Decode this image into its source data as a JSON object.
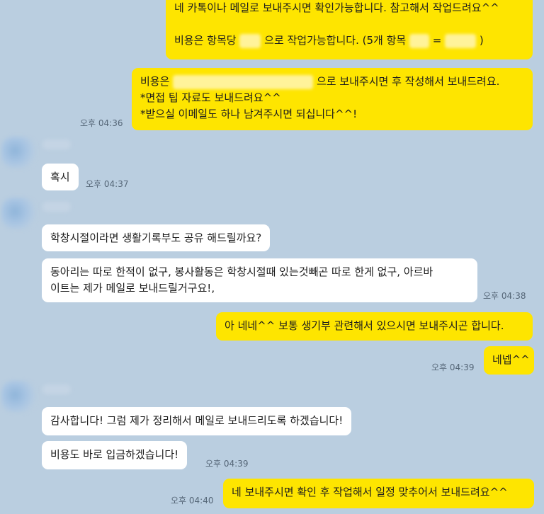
{
  "messages": {
    "m1": {
      "line1": "네 카톡이나 메일로 보내주시면 확인가능합니다. 참고해서 작업드려요^^",
      "line2a": "비용은 항목당",
      "line2b": "으로 작업가능합니다. (5개 항목",
      "line2c": "=",
      "line2d": ")"
    },
    "m2": {
      "line1a": "비용은",
      "line1b": "으로 보내주시면 후 작성해서 보내드려요.",
      "line2": "*면접 팁 자료도 보내드려요^^",
      "line3": "*받으실 이메일도 하나 남겨주시면 되십니다^^!",
      "time": "오후 04:36"
    },
    "m3": {
      "text": "혹시",
      "time": "오후 04:37"
    },
    "m4": {
      "text": "학창시절이라면 생활기록부도 공유 해드릴까요?"
    },
    "m5": {
      "line1": "동아리는 따로 한적이 없구, 봉사활동은 학창시절때 있는것빼곤 따로 한게 없구, 아르바",
      "line2": "이트는 제가 메일로 보내드릴거구요!,",
      "time": "오후 04:38"
    },
    "m6": {
      "text": "아 네네^^ 보통 생기부 관련해서 있으시면 보내주시곤 합니다."
    },
    "m7": {
      "text": "네넵^^",
      "time": "오후 04:39"
    },
    "m8": {
      "text": "감사합니다! 그럼 제가 정리해서 메일로 보내드리도록 하겠습니다!"
    },
    "m9": {
      "text": "비용도 바로 입금하겠습니다!",
      "time": "오후 04:39"
    },
    "m10": {
      "text": "네 보내주시면 확인 후 작업해서 일정 맞추어서 보내드려요^^",
      "time": "오후 04:40"
    }
  },
  "colors": {
    "background": "#bacee0",
    "my_bubble": "#fee500",
    "other_bubble": "#ffffff"
  }
}
